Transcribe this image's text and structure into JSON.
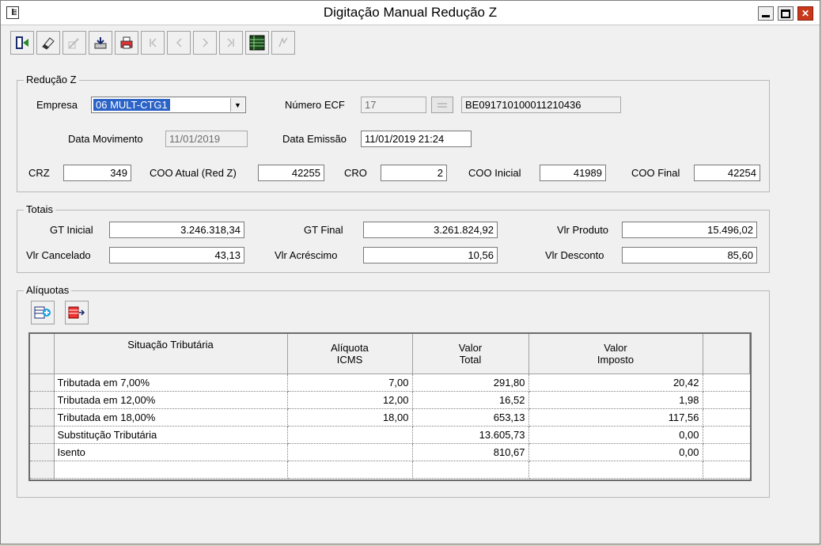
{
  "window": {
    "title": "Digitação Manual Redução Z",
    "close_glyph": "✕"
  },
  "toolbar": {
    "icons": [
      "exit-icon",
      "eraser-icon",
      "edit-icon",
      "save-icon",
      "print-icon",
      "first-icon",
      "prev-icon",
      "next-icon",
      "last-icon",
      "grid-icon",
      "refresh-icon"
    ]
  },
  "reducao": {
    "group_label": "Redução Z",
    "empresa_label": "Empresa",
    "empresa_value": "06 MULT-CTG1",
    "ecf_label": "Número ECF",
    "ecf_value": "17",
    "ecf_serial": "BE091710100011210436",
    "data_mov_label": "Data Movimento",
    "data_mov_value": "11/01/2019",
    "data_emissao_label": "Data Emissão",
    "data_emissao_value": "11/01/2019 21:24",
    "crz_label": "CRZ",
    "crz_value": "349",
    "coo_atual_label": "COO Atual (Red Z)",
    "coo_atual_value": "42255",
    "cro_label": "CRO",
    "cro_value": "2",
    "coo_inicial_label": "COO Inicial",
    "coo_inicial_value": "41989",
    "coo_final_label": "COO Final",
    "coo_final_value": "42254"
  },
  "totais": {
    "group_label": "Totais",
    "gt_inicial_label": "GT Inicial",
    "gt_inicial_value": "3.246.318,34",
    "gt_final_label": "GT Final",
    "gt_final_value": "3.261.824,92",
    "vlr_produto_label": "Vlr Produto",
    "vlr_produto_value": "15.496,02",
    "vlr_cancelado_label": "Vlr Cancelado",
    "vlr_cancelado_value": "43,13",
    "vlr_acrescimo_label": "Vlr Acréscimo",
    "vlr_acrescimo_value": "10,56",
    "vlr_desconto_label": "Vlr Desconto",
    "vlr_desconto_value": "85,60"
  },
  "aliquotas": {
    "group_label": "Alíquotas",
    "columns": {
      "situacao": "Situação Tributária",
      "aliquota_1": "Alíquota",
      "aliquota_2": "ICMS",
      "total_1": "Valor",
      "total_2": "Total",
      "imposto_1": "Valor",
      "imposto_2": "Imposto"
    },
    "rows": [
      {
        "situacao": "Tributada em 7,00%",
        "aliquota": "7,00",
        "total": "291,80",
        "imposto": "20,42"
      },
      {
        "situacao": "Tributada em 12,00%",
        "aliquota": "12,00",
        "total": "16,52",
        "imposto": "1,98"
      },
      {
        "situacao": "Tributada em 18,00%",
        "aliquota": "18,00",
        "total": "653,13",
        "imposto": "117,56"
      },
      {
        "situacao": "Substitução Tributária",
        "aliquota": "",
        "total": "13.605,73",
        "imposto": "0,00"
      },
      {
        "situacao": "Isento",
        "aliquota": "",
        "total": "810,67",
        "imposto": "0,00"
      },
      {
        "situacao": "",
        "aliquota": "",
        "total": "",
        "imposto": ""
      }
    ]
  }
}
